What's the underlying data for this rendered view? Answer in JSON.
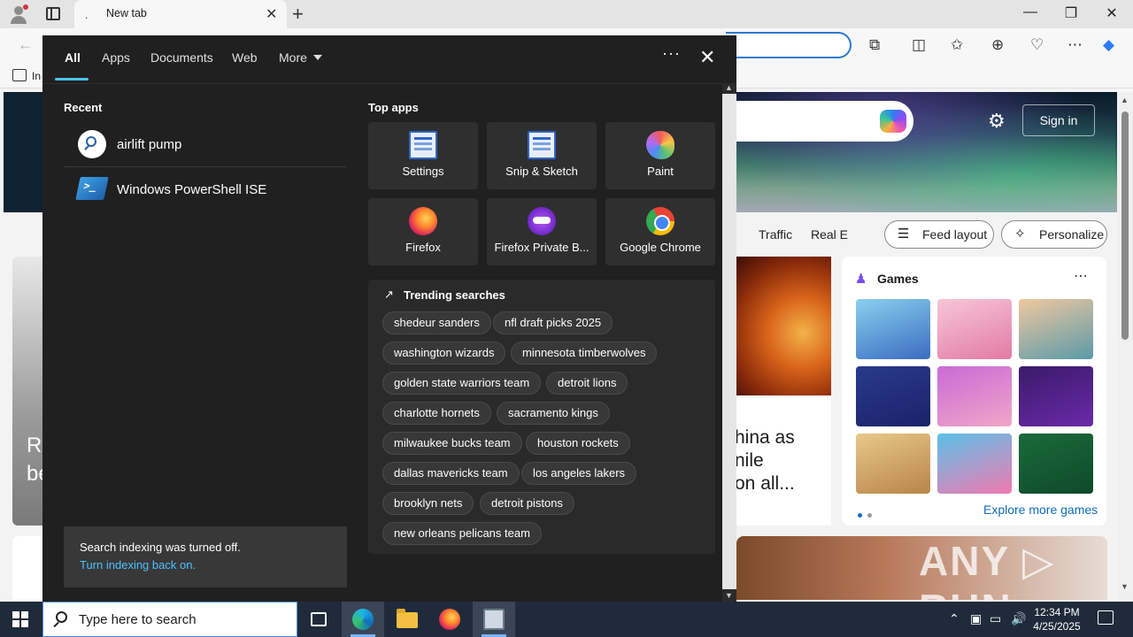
{
  "browser": {
    "tab_title": "New tab",
    "tab_favicon": ".",
    "close_tab": "✕",
    "new_tab": "+",
    "window_controls": {
      "minimize": "—",
      "restore": "❐",
      "close": "✕"
    },
    "bookmark_partial": "In"
  },
  "ntp": {
    "sign_in": "Sign in",
    "nav_items": [
      "Traffic",
      "Real E"
    ],
    "feed_layout": "Feed layout",
    "personalize": "Personalize",
    "headline_fragment": [
      "hina as",
      "nile",
      "on all..."
    ],
    "left_headline": [
      "Re",
      "be"
    ],
    "games": {
      "title": "Games",
      "explore": "Explore more games"
    },
    "watermark": "ANY ▷ RUN"
  },
  "start_panel": {
    "tabs": [
      "All",
      "Apps",
      "Documents",
      "Web",
      "More"
    ],
    "recent_title": "Recent",
    "recent": [
      {
        "label": "airlift pump",
        "icon": "search-icon"
      },
      {
        "label": "Windows PowerShell ISE",
        "icon": "powershell-icon"
      }
    ],
    "top_apps_title": "Top apps",
    "top_apps": [
      {
        "label": "Settings",
        "icon": "settings-app-icon"
      },
      {
        "label": "Snip & Sketch",
        "icon": "snip-sketch-icon"
      },
      {
        "label": "Paint",
        "icon": "paint-icon"
      },
      {
        "label": "Firefox",
        "icon": "firefox-icon"
      },
      {
        "label": "Firefox Private B...",
        "icon": "firefox-private-icon"
      },
      {
        "label": "Google Chrome",
        "icon": "chrome-icon"
      }
    ],
    "trending_title": "Trending searches",
    "trending": [
      "shedeur sanders",
      "nfl draft picks 2025",
      "washington wizards",
      "minnesota timberwolves",
      "golden state warriors team",
      "detroit lions",
      "charlotte hornets",
      "sacramento kings",
      "milwaukee bucks team",
      "houston rockets",
      "dallas mavericks team",
      "los angeles lakers",
      "brooklyn nets",
      "detroit pistons",
      "new orleans pelicans team"
    ],
    "indexing_message": "Search indexing was turned off.",
    "indexing_link": "Turn indexing back on."
  },
  "taskbar": {
    "search_placeholder": "Type here to search",
    "time": "12:34 PM",
    "date": "4/25/2025"
  },
  "colors": {
    "panel_bg": "#202020",
    "accent": "#4cc2ff",
    "taskbar_bg": "#1f2b3a"
  }
}
